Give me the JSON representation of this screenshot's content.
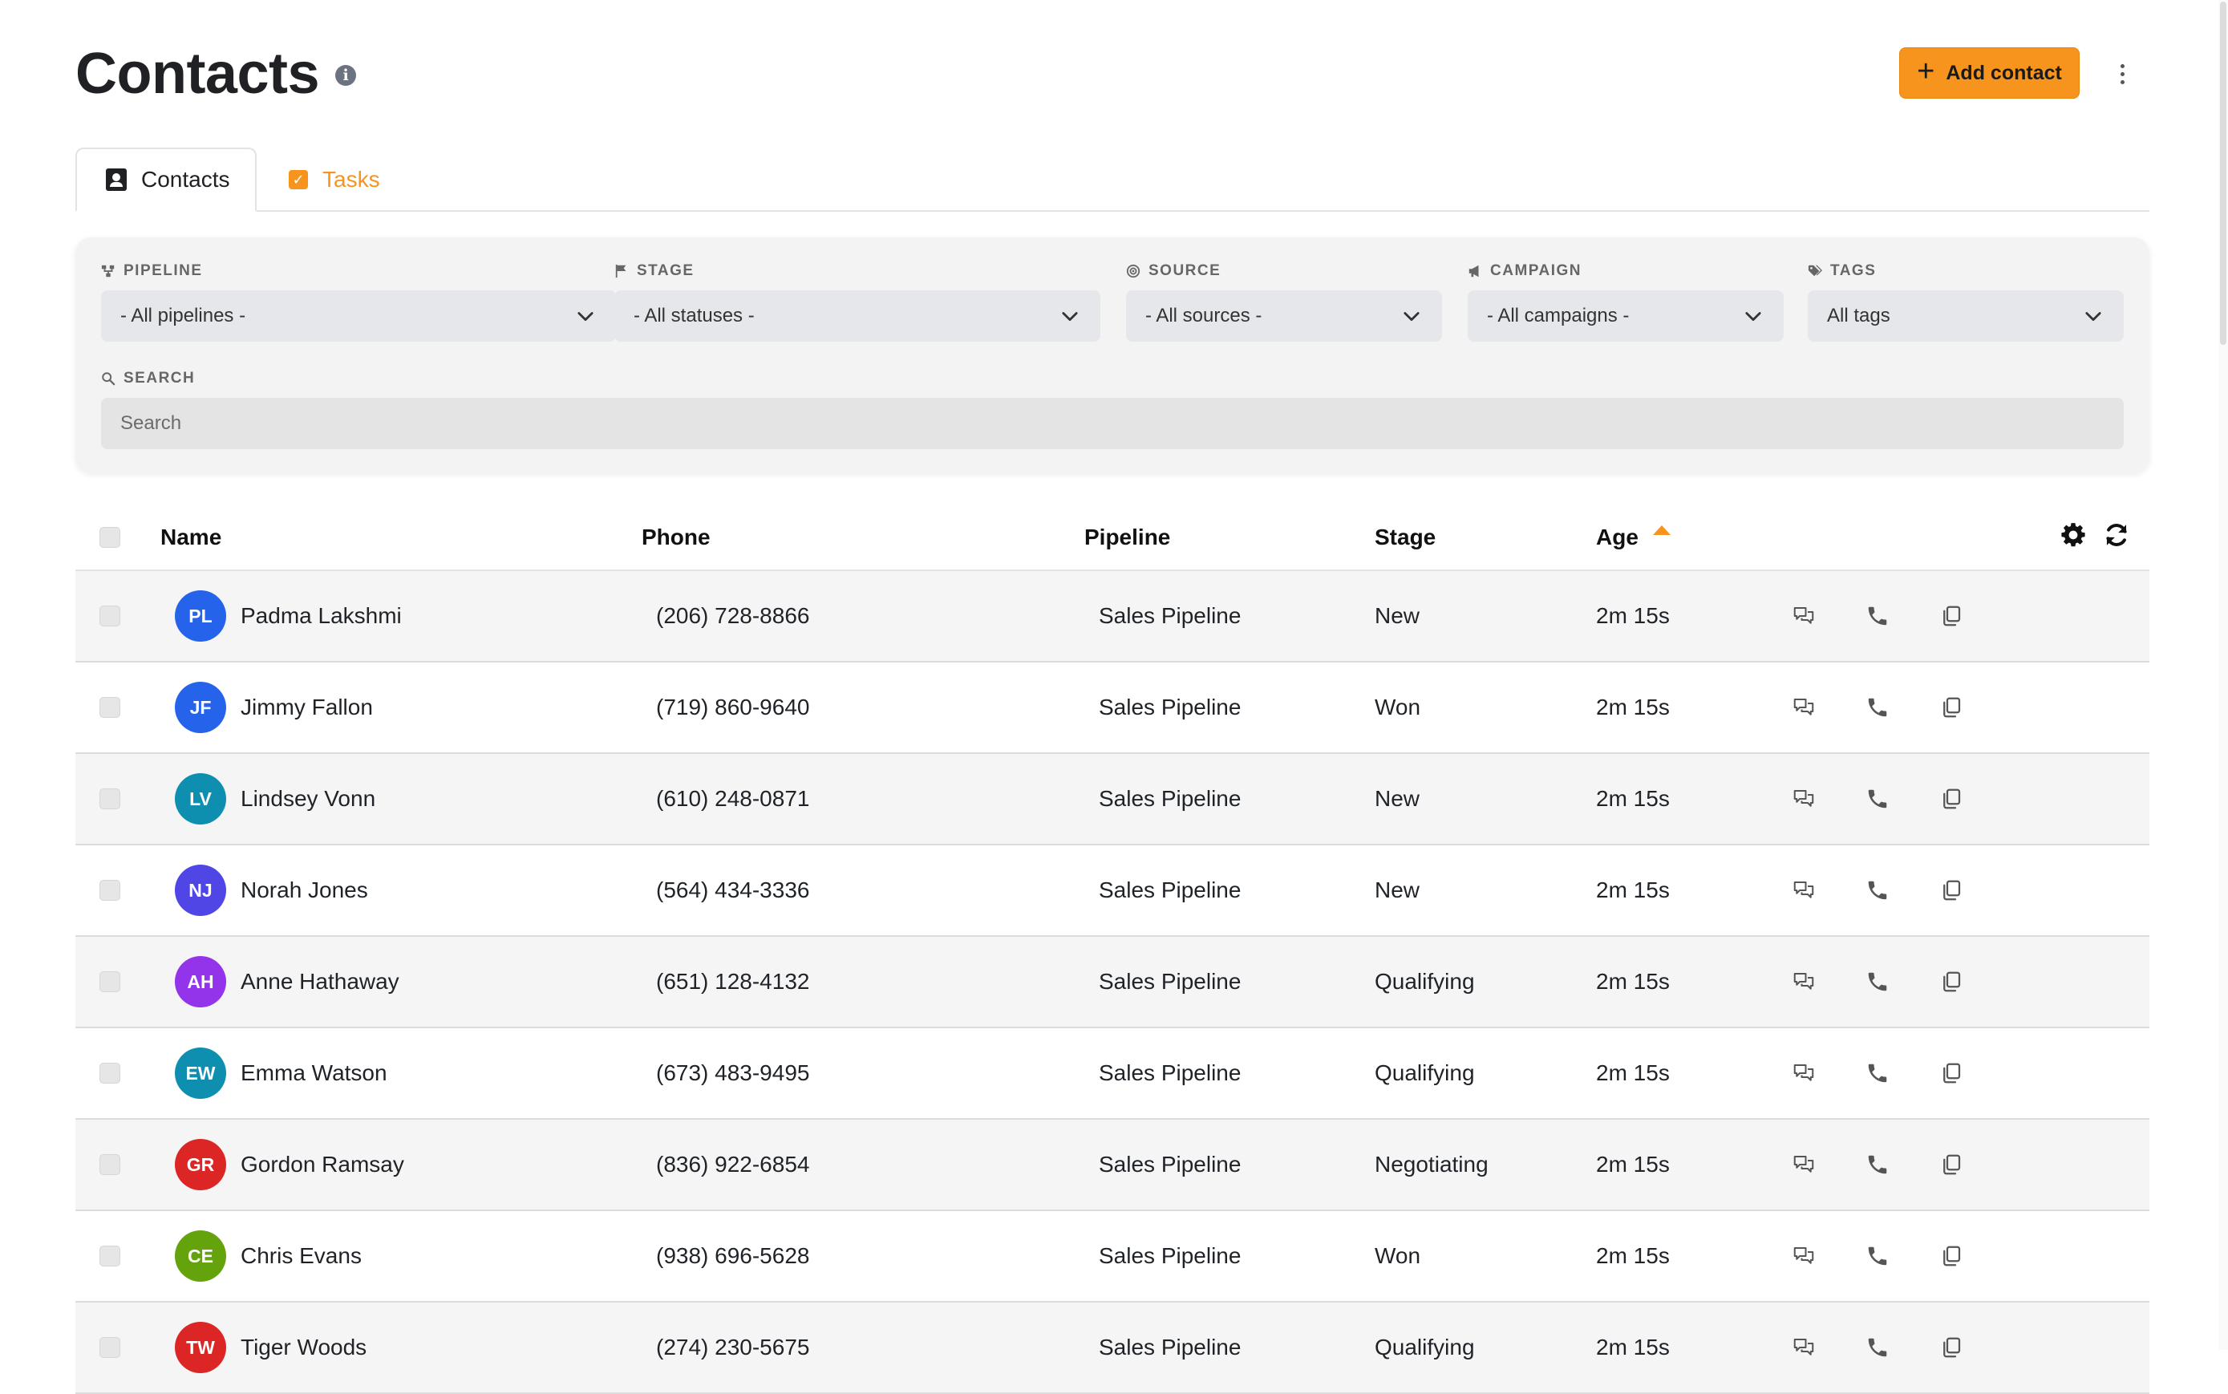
{
  "header": {
    "title": "Contacts",
    "add_button_label": "Add contact"
  },
  "tabs": [
    {
      "label": "Contacts",
      "active": true
    },
    {
      "label": "Tasks",
      "active": false
    }
  ],
  "filters": {
    "pipeline": {
      "label": "PIPELINE",
      "value": "- All pipelines -"
    },
    "stage": {
      "label": "STAGE",
      "value": "- All statuses -"
    },
    "source": {
      "label": "SOURCE",
      "value": "- All sources -"
    },
    "campaign": {
      "label": "CAMPAIGN",
      "value": "- All campaigns -"
    },
    "tags": {
      "label": "TAGS",
      "value": "All tags"
    },
    "search": {
      "label": "SEARCH",
      "placeholder": "Search"
    }
  },
  "table": {
    "columns": {
      "name": "Name",
      "phone": "Phone",
      "pipeline": "Pipeline",
      "stage": "Stage",
      "age": "Age"
    },
    "sort": {
      "column": "Age",
      "direction": "ascending"
    },
    "rows": [
      {
        "initials": "PL",
        "name": "Padma Lakshmi",
        "phone": "(206) 728-8866",
        "pipeline": "Sales Pipeline",
        "stage": "New",
        "age": "2m 15s",
        "color": "#2563eb"
      },
      {
        "initials": "JF",
        "name": "Jimmy Fallon",
        "phone": "(719) 860-9640",
        "pipeline": "Sales Pipeline",
        "stage": "Won",
        "age": "2m 15s",
        "color": "#2563eb"
      },
      {
        "initials": "LV",
        "name": "Lindsey Vonn",
        "phone": "(610) 248-0871",
        "pipeline": "Sales Pipeline",
        "stage": "New",
        "age": "2m 15s",
        "color": "#0e8fb0"
      },
      {
        "initials": "NJ",
        "name": "Norah Jones",
        "phone": "(564) 434-3336",
        "pipeline": "Sales Pipeline",
        "stage": "New",
        "age": "2m 15s",
        "color": "#4f46e5"
      },
      {
        "initials": "AH",
        "name": "Anne Hathaway",
        "phone": "(651) 128-4132",
        "pipeline": "Sales Pipeline",
        "stage": "Qualifying",
        "age": "2m 15s",
        "color": "#9333ea"
      },
      {
        "initials": "EW",
        "name": "Emma Watson",
        "phone": "(673) 483-9495",
        "pipeline": "Sales Pipeline",
        "stage": "Qualifying",
        "age": "2m 15s",
        "color": "#0e8fb0"
      },
      {
        "initials": "GR",
        "name": "Gordon Ramsay",
        "phone": "(836) 922-6854",
        "pipeline": "Sales Pipeline",
        "stage": "Negotiating",
        "age": "2m 15s",
        "color": "#dc2626"
      },
      {
        "initials": "CE",
        "name": "Chris Evans",
        "phone": "(938) 696-5628",
        "pipeline": "Sales Pipeline",
        "stage": "Won",
        "age": "2m 15s",
        "color": "#65a30d"
      },
      {
        "initials": "TW",
        "name": "Tiger Woods",
        "phone": "(274) 230-5675",
        "pipeline": "Sales Pipeline",
        "stage": "Qualifying",
        "age": "2m 15s",
        "color": "#dc2626"
      }
    ]
  },
  "icons": {
    "info": "info-icon",
    "add": "plus-icon",
    "more": "kebab-icon",
    "settings": "gear-icon",
    "refresh": "refresh-icon",
    "message": "chat-icon",
    "call": "phone-icon",
    "copy": "copy-icon"
  },
  "colors": {
    "accent": "#f7941d",
    "row_alt": "#f5f5f5",
    "panel": "#f3f3f3"
  }
}
